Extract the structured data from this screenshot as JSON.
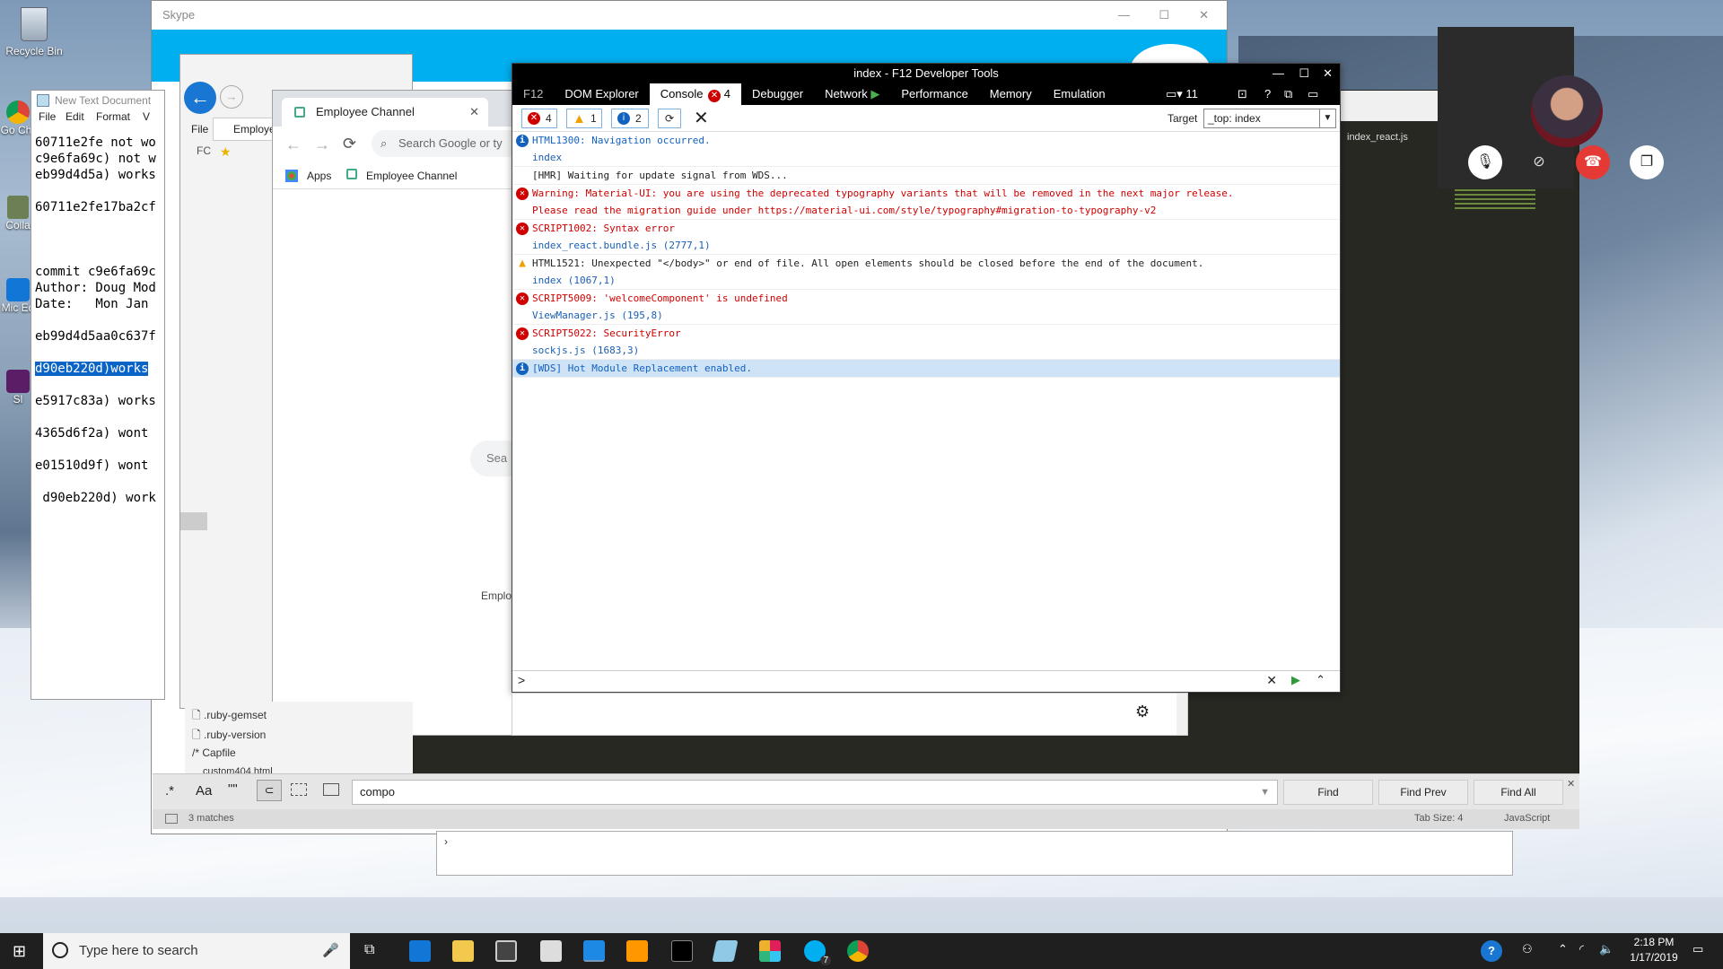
{
  "desktop": {
    "recycle_bin": "Recycle Bin",
    "icon_labels": [
      "Go Chr",
      "Colla",
      "Mic Ed",
      "Sl"
    ]
  },
  "skype": {
    "title": "Skype"
  },
  "notepad": {
    "title": "New Text Document",
    "menu": [
      "File",
      "Edit",
      "Format",
      "V"
    ],
    "lines": [
      "60711e2fe not wo",
      "c9e6fa69c) not w",
      "eb99d4d5a) works",
      "",
      "60711e2fe17ba2cf",
      "",
      "",
      "",
      "commit c9e6fa69c",
      "Author: Doug Mod",
      "Date:   Mon Jan ",
      "",
      "eb99d4d5aa0c637f",
      "",
      "d90eb220d)works",
      "",
      "e5917c83a) works",
      "",
      "4365d6f2a) wont ",
      "",
      "e01510d9f) wont ",
      "",
      " d90eb220d) work"
    ]
  },
  "ie_back": {
    "tab_label": "Employee Cha",
    "menu_file": "File",
    "fo": "FC"
  },
  "chrome": {
    "tab_label": "Employee Channel",
    "omnibox_placeholder": "Search Google or ty",
    "bookmarks": [
      "Apps",
      "Employee Channel"
    ],
    "search_pill": "Sea",
    "employee_label": "Emplo"
  },
  "editor": {
    "file_tab": "index_react.js",
    "files": [
      ".ruby-gemset",
      ".ruby-version",
      "Capfile",
      "custom404.html"
    ],
    "find": {
      "value": "compo",
      "buttons": [
        "Find",
        "Find Prev",
        "Find All"
      ],
      "options": [
        ".*",
        "Aa",
        "\"\""
      ]
    },
    "status": {
      "matches": "3 matches",
      "tab_size": "Tab Size: 4",
      "syntax": "JavaScript"
    }
  },
  "devtools": {
    "title": "index - F12 Developer Tools",
    "tabs": [
      "F12",
      "DOM Explorer",
      "Console",
      "Debugger",
      "Network",
      "Performance",
      "Memory",
      "Emulation"
    ],
    "console_error_count": "4",
    "device_count": "11",
    "counts": {
      "errors": "4",
      "warnings": "1",
      "info": "2"
    },
    "target_label": "Target",
    "target_value": "_top: index",
    "messages": [
      {
        "type": "info",
        "text": "HTML1300: Navigation occurred.",
        "source": "index"
      },
      {
        "type": "plain",
        "text": "[HMR] Waiting for update signal from WDS...",
        "source": ""
      },
      {
        "type": "error",
        "text": "Warning: Material-UI: you are using the deprecated typography variants that will be removed in the next major release.",
        "source": "Please read the migration guide under https://material-ui.com/style/typography#migration-to-typography-v2"
      },
      {
        "type": "error",
        "text": "SCRIPT1002: Syntax error",
        "source": "index_react.bundle.js (2777,1)"
      },
      {
        "type": "warning",
        "text": "HTML1521: Unexpected \"</body>\" or end of file. All open elements should be closed before the end of the document.",
        "source": "index (1067,1)"
      },
      {
        "type": "error",
        "text": "SCRIPT5009: 'welcomeComponent' is undefined",
        "source": "ViewManager.js (195,8)"
      },
      {
        "type": "error",
        "text": "SCRIPT5022: SecurityError",
        "source": "sockjs.js (1683,3)"
      },
      {
        "type": "info",
        "text": "[WDS] Hot Module Replacement enabled.",
        "source": ""
      }
    ],
    "prompt": ">"
  },
  "taskbar": {
    "search_placeholder": "Type here to search",
    "time": "2:18 PM",
    "date": "1/17/2019",
    "skype_badge": "7"
  },
  "colors": {
    "skype_blue": "#00aff0",
    "error_red": "#d00000",
    "info_blue": "#1462c0",
    "warning_orange": "#f0a000",
    "editor_bg": "#272822"
  }
}
